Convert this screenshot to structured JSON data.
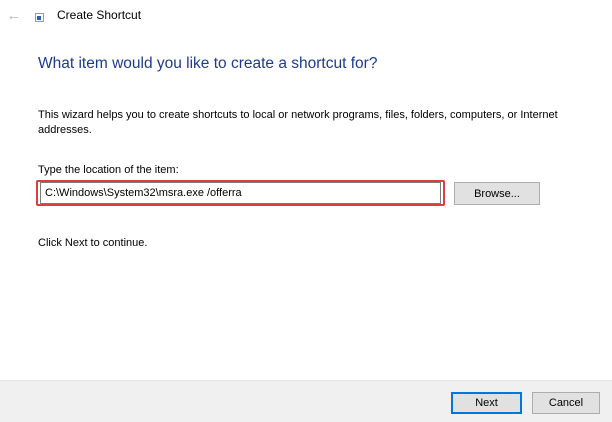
{
  "window": {
    "title": "Create Shortcut",
    "back_icon": "arrow-left-icon",
    "app_icon": "shortcut-icon"
  },
  "main": {
    "heading": "What item would you like to create a shortcut for?",
    "description": "This wizard helps you to create shortcuts to local or network programs, files, folders, computers, or Internet addresses.",
    "location_label": "Type the location of the item:",
    "location_value": "C:\\Windows\\System32\\msra.exe /offerra",
    "browse_label": "Browse...",
    "continue_text": "Click Next to continue."
  },
  "footer": {
    "next_label": "Next",
    "cancel_label": "Cancel"
  },
  "colors": {
    "heading": "#1c3b8f",
    "highlight": "#e03c3c",
    "focus_border": "#0078d7",
    "footer_bg": "#f0f0f0"
  }
}
